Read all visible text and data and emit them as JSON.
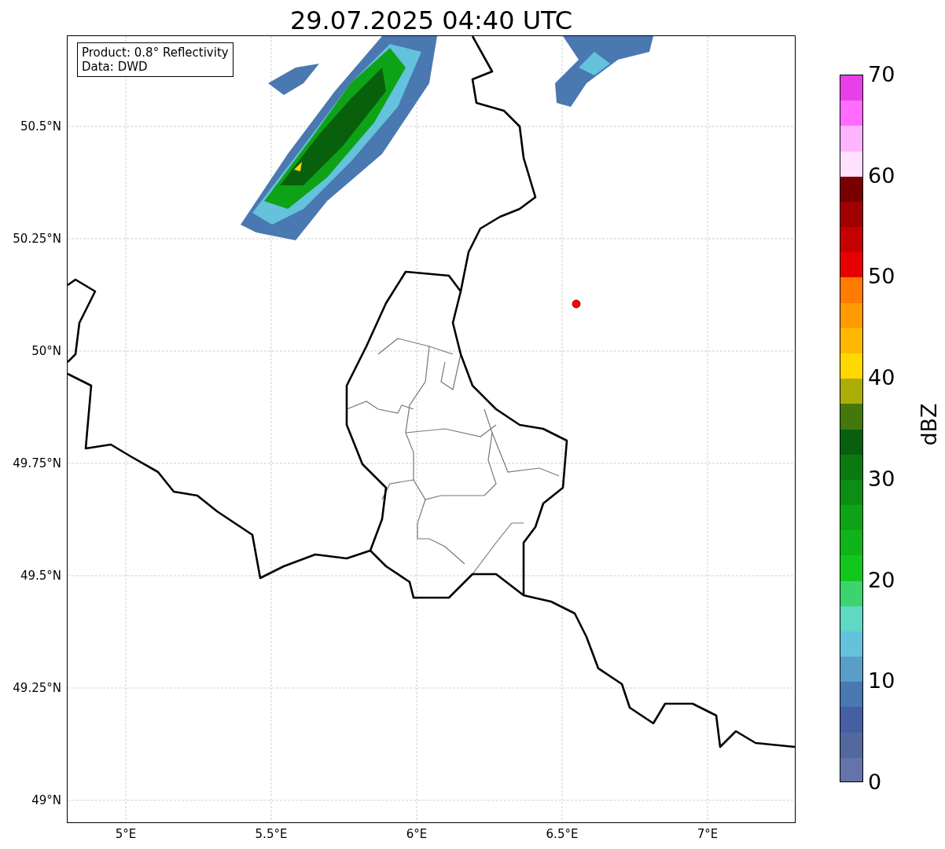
{
  "title": "29.07.2025 04:40 UTC",
  "info_box": [
    "Product: 0.8° Reflectivity",
    "Data: DWD"
  ],
  "map": {
    "kind": "radar",
    "lat_ticks": [
      "50.5°N",
      "50.25°N",
      "50°N",
      "49.75°N",
      "49.5°N",
      "49.25°N",
      "49°N"
    ],
    "lon_ticks": [
      "5°E",
      "5.5°E",
      "6°E",
      "6.5°E",
      "7°E"
    ]
  },
  "colorbar": {
    "label": "dBZ",
    "ticks": [
      "70",
      "60",
      "50",
      "40",
      "30",
      "20",
      "10",
      "0"
    ],
    "segments": [
      {
        "color": "#e840e8"
      },
      {
        "color": "#ff6cff"
      },
      {
        "color": "#ffb4ff"
      },
      {
        "color": "#ffe0ff"
      },
      {
        "color": "#7a0000"
      },
      {
        "color": "#a00000"
      },
      {
        "color": "#c40000"
      },
      {
        "color": "#e80000"
      },
      {
        "color": "#ff7c00"
      },
      {
        "color": "#ff9a00"
      },
      {
        "color": "#ffb800"
      },
      {
        "color": "#ffd800"
      },
      {
        "color": "#acae08"
      },
      {
        "color": "#44780c"
      },
      {
        "color": "#08600c"
      },
      {
        "color": "#0a7a10"
      },
      {
        "color": "#0c8e14"
      },
      {
        "color": "#0ea316"
      },
      {
        "color": "#10b41a"
      },
      {
        "color": "#12c61c"
      },
      {
        "color": "#3cd46c"
      },
      {
        "color": "#60d8c4"
      },
      {
        "color": "#64c2dc"
      },
      {
        "color": "#5a9ec8"
      },
      {
        "color": "#4a78b0"
      },
      {
        "color": "#4460a2"
      },
      {
        "color": "#5468a0"
      },
      {
        "color": "#6474a8"
      }
    ]
  }
}
